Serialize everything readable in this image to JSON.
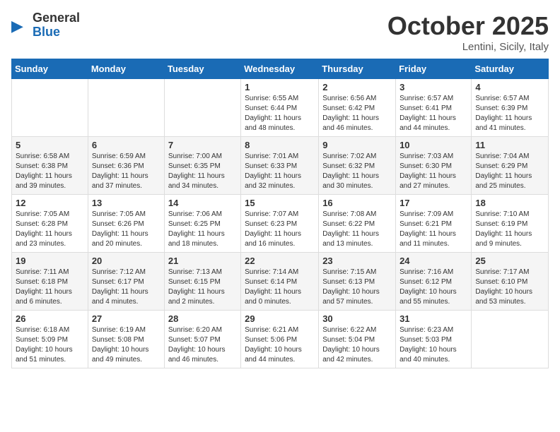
{
  "header": {
    "logo": {
      "general": "General",
      "blue": "Blue"
    },
    "title": "October 2025",
    "location": "Lentini, Sicily, Italy"
  },
  "weekdays": [
    "Sunday",
    "Monday",
    "Tuesday",
    "Wednesday",
    "Thursday",
    "Friday",
    "Saturday"
  ],
  "weeks": [
    [
      {
        "day": "",
        "info": ""
      },
      {
        "day": "",
        "info": ""
      },
      {
        "day": "",
        "info": ""
      },
      {
        "day": "1",
        "info": "Sunrise: 6:55 AM\nSunset: 6:44 PM\nDaylight: 11 hours\nand 48 minutes."
      },
      {
        "day": "2",
        "info": "Sunrise: 6:56 AM\nSunset: 6:42 PM\nDaylight: 11 hours\nand 46 minutes."
      },
      {
        "day": "3",
        "info": "Sunrise: 6:57 AM\nSunset: 6:41 PM\nDaylight: 11 hours\nand 44 minutes."
      },
      {
        "day": "4",
        "info": "Sunrise: 6:57 AM\nSunset: 6:39 PM\nDaylight: 11 hours\nand 41 minutes."
      }
    ],
    [
      {
        "day": "5",
        "info": "Sunrise: 6:58 AM\nSunset: 6:38 PM\nDaylight: 11 hours\nand 39 minutes."
      },
      {
        "day": "6",
        "info": "Sunrise: 6:59 AM\nSunset: 6:36 PM\nDaylight: 11 hours\nand 37 minutes."
      },
      {
        "day": "7",
        "info": "Sunrise: 7:00 AM\nSunset: 6:35 PM\nDaylight: 11 hours\nand 34 minutes."
      },
      {
        "day": "8",
        "info": "Sunrise: 7:01 AM\nSunset: 6:33 PM\nDaylight: 11 hours\nand 32 minutes."
      },
      {
        "day": "9",
        "info": "Sunrise: 7:02 AM\nSunset: 6:32 PM\nDaylight: 11 hours\nand 30 minutes."
      },
      {
        "day": "10",
        "info": "Sunrise: 7:03 AM\nSunset: 6:30 PM\nDaylight: 11 hours\nand 27 minutes."
      },
      {
        "day": "11",
        "info": "Sunrise: 7:04 AM\nSunset: 6:29 PM\nDaylight: 11 hours\nand 25 minutes."
      }
    ],
    [
      {
        "day": "12",
        "info": "Sunrise: 7:05 AM\nSunset: 6:28 PM\nDaylight: 11 hours\nand 23 minutes."
      },
      {
        "day": "13",
        "info": "Sunrise: 7:05 AM\nSunset: 6:26 PM\nDaylight: 11 hours\nand 20 minutes."
      },
      {
        "day": "14",
        "info": "Sunrise: 7:06 AM\nSunset: 6:25 PM\nDaylight: 11 hours\nand 18 minutes."
      },
      {
        "day": "15",
        "info": "Sunrise: 7:07 AM\nSunset: 6:23 PM\nDaylight: 11 hours\nand 16 minutes."
      },
      {
        "day": "16",
        "info": "Sunrise: 7:08 AM\nSunset: 6:22 PM\nDaylight: 11 hours\nand 13 minutes."
      },
      {
        "day": "17",
        "info": "Sunrise: 7:09 AM\nSunset: 6:21 PM\nDaylight: 11 hours\nand 11 minutes."
      },
      {
        "day": "18",
        "info": "Sunrise: 7:10 AM\nSunset: 6:19 PM\nDaylight: 11 hours\nand 9 minutes."
      }
    ],
    [
      {
        "day": "19",
        "info": "Sunrise: 7:11 AM\nSunset: 6:18 PM\nDaylight: 11 hours\nand 6 minutes."
      },
      {
        "day": "20",
        "info": "Sunrise: 7:12 AM\nSunset: 6:17 PM\nDaylight: 11 hours\nand 4 minutes."
      },
      {
        "day": "21",
        "info": "Sunrise: 7:13 AM\nSunset: 6:15 PM\nDaylight: 11 hours\nand 2 minutes."
      },
      {
        "day": "22",
        "info": "Sunrise: 7:14 AM\nSunset: 6:14 PM\nDaylight: 11 hours\nand 0 minutes."
      },
      {
        "day": "23",
        "info": "Sunrise: 7:15 AM\nSunset: 6:13 PM\nDaylight: 10 hours\nand 57 minutes."
      },
      {
        "day": "24",
        "info": "Sunrise: 7:16 AM\nSunset: 6:12 PM\nDaylight: 10 hours\nand 55 minutes."
      },
      {
        "day": "25",
        "info": "Sunrise: 7:17 AM\nSunset: 6:10 PM\nDaylight: 10 hours\nand 53 minutes."
      }
    ],
    [
      {
        "day": "26",
        "info": "Sunrise: 6:18 AM\nSunset: 5:09 PM\nDaylight: 10 hours\nand 51 minutes."
      },
      {
        "day": "27",
        "info": "Sunrise: 6:19 AM\nSunset: 5:08 PM\nDaylight: 10 hours\nand 49 minutes."
      },
      {
        "day": "28",
        "info": "Sunrise: 6:20 AM\nSunset: 5:07 PM\nDaylight: 10 hours\nand 46 minutes."
      },
      {
        "day": "29",
        "info": "Sunrise: 6:21 AM\nSunset: 5:06 PM\nDaylight: 10 hours\nand 44 minutes."
      },
      {
        "day": "30",
        "info": "Sunrise: 6:22 AM\nSunset: 5:04 PM\nDaylight: 10 hours\nand 42 minutes."
      },
      {
        "day": "31",
        "info": "Sunrise: 6:23 AM\nSunset: 5:03 PM\nDaylight: 10 hours\nand 40 minutes."
      },
      {
        "day": "",
        "info": ""
      }
    ]
  ]
}
